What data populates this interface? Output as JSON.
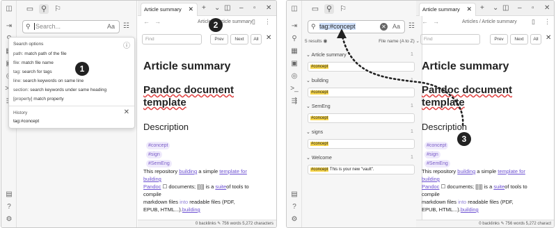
{
  "left": {
    "search": {
      "placeholder": "Search...",
      "case_label": "Aa"
    },
    "popup": {
      "title": "Search options",
      "options": [
        {
          "key": "path:",
          "desc": "match path of the file"
        },
        {
          "key": "file:",
          "desc": "match file name"
        },
        {
          "key": "tag:",
          "desc": "search for tags"
        },
        {
          "key": "line:",
          "desc": "search keywords on same line"
        },
        {
          "key": "section:",
          "desc": "search keywords under same heading"
        },
        {
          "key": "[property]",
          "desc": "match property"
        }
      ],
      "history_title": "History",
      "history_item": "tag:#concept"
    },
    "badge1": "1",
    "badge2": "2",
    "tab_title": "Article summary",
    "breadcrumb": "Articles / Article summary",
    "find_placeholder": "Find",
    "find_prev": "Prev",
    "find_next": "Next",
    "find_all": "All",
    "doc": {
      "title": "Article summary",
      "heading": "Pandoc document template",
      "section": "Description",
      "tags": [
        "#concept",
        "#sign",
        "#SemEng"
      ],
      "para": [
        [
          "This repository ",
          "building",
          " a simple ",
          "template for"
        ],
        [
          "building"
        ],
        [
          "Pandoc",
          " ☐ documents; ",
          "[[|]]",
          " is a ",
          "suite",
          "of tools to"
        ],
        [
          "compile"
        ],
        [
          "markdown files ",
          "into",
          " readable files (PDF,"
        ],
        [
          "EPUB, HTML...).",
          "building"
        ]
      ]
    },
    "status": "0 backlinks   ✎ 756 words 5,272 characters"
  },
  "right": {
    "search": {
      "value": "tag:#concept",
      "case_label": "Aa"
    },
    "results_count": "5 results",
    "sort_label": "File name (A to Z)",
    "groups": [
      {
        "name": "Article summary",
        "count": "1",
        "snippet_tag": "#concept",
        "snippet_rest": ""
      },
      {
        "name": "building",
        "count": "1",
        "snippet_tag": "#concept",
        "snippet_rest": ""
      },
      {
        "name": "SemEng",
        "count": "1",
        "snippet_tag": "#concept",
        "snippet_rest": ""
      },
      {
        "name": "signs",
        "count": "1",
        "snippet_tag": "#concept",
        "snippet_rest": ""
      },
      {
        "name": "Welcome",
        "count": "1",
        "snippet_tag": "#concept",
        "snippet_rest": " This is your new \"vault\"."
      }
    ],
    "badge3": "3",
    "tab_title": "Article summary",
    "breadcrumb": "Articles / Article summary",
    "find_placeholder": "Find",
    "find_prev": "Prev",
    "find_next": "Next",
    "find_all": "All",
    "doc": {
      "title": "Article summary",
      "heading": "Pandoc document template",
      "section": "Description",
      "tags": [
        "#concept",
        "#sign",
        "#SemEng"
      ],
      "para": [
        [
          "This repository ",
          "building",
          " a simple ",
          "template for"
        ],
        [
          "building"
        ],
        [
          "Pandoc",
          " ☐ documents; ",
          "[[|]]",
          " is a ",
          "suite",
          "of tools to"
        ],
        [
          "compile"
        ],
        [
          "markdown files ",
          "into",
          " readable files (PDF,"
        ],
        [
          "EPUB, HTML...).",
          "building"
        ]
      ]
    },
    "status": "0 backlinks   ✎ 756 words 5,272 charact"
  },
  "colors": {
    "accent": "#7a5cc7",
    "highlight": "#f7d548",
    "link": "#6b4fd1"
  },
  "icons": [
    "sidebar-toggle-icon",
    "files-icon",
    "search-icon",
    "bookmark-icon",
    "graph-icon",
    "canvas-icon",
    "daily-note-icon",
    "command-icon",
    "template-icon",
    "help-icon",
    "settings-icon",
    "vault-icon"
  ]
}
